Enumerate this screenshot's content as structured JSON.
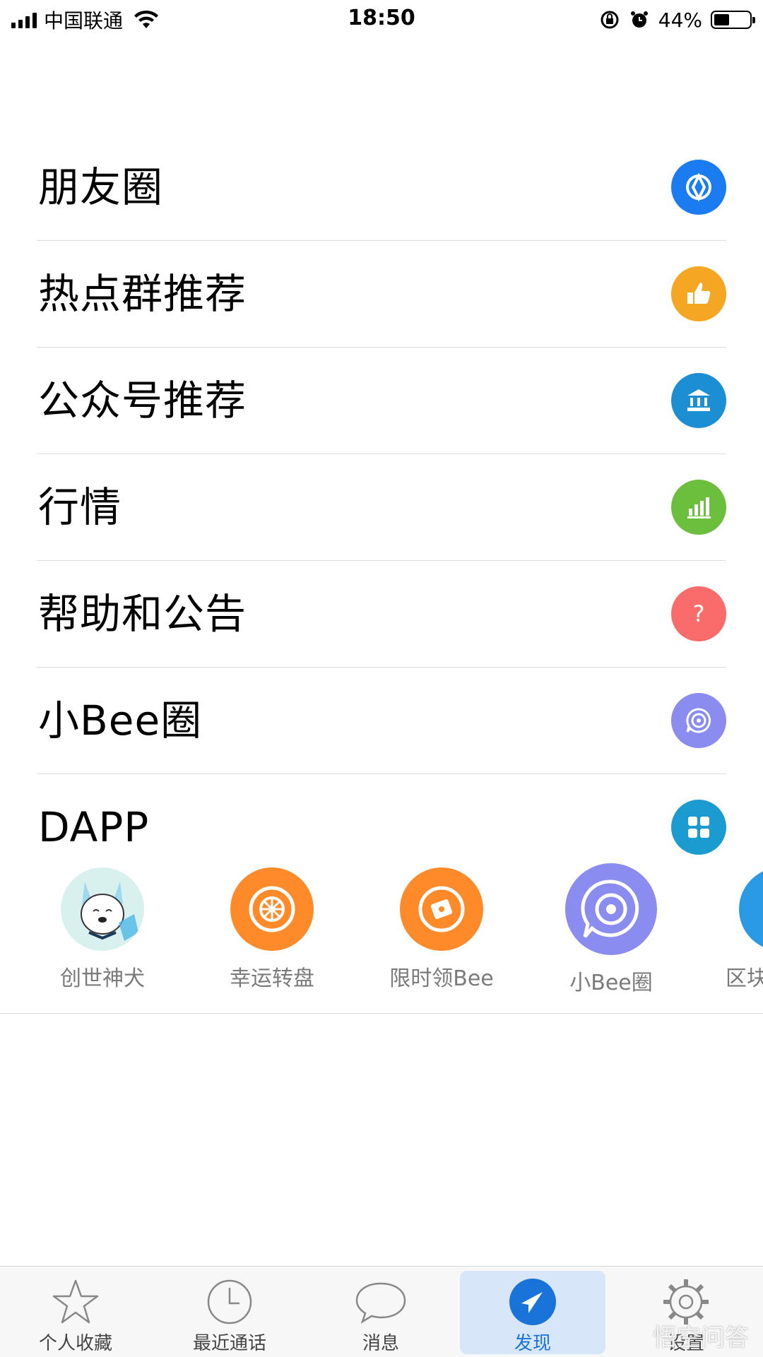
{
  "status_bar": {
    "carrier": "中国联通",
    "time": "18:50",
    "battery_percent": "44%",
    "battery_level": 0.44
  },
  "menu": {
    "items": [
      {
        "label": "朋友圈",
        "icon": "moments-shutter-icon",
        "color": "#1a7cf0"
      },
      {
        "label": "热点群推荐",
        "icon": "thumbs-up-icon",
        "color": "#f5a623"
      },
      {
        "label": "公众号推荐",
        "icon": "bank-building-icon",
        "color": "#1b8ed4"
      },
      {
        "label": "行情",
        "icon": "bar-chart-icon",
        "color": "#6cbf3c"
      },
      {
        "label": "帮助和公告",
        "icon": "question-icon",
        "color": "#fa6b6b"
      },
      {
        "label": "小Bee圈",
        "icon": "chat-target-icon",
        "color": "#8b8cf0"
      },
      {
        "label": "DAPP",
        "icon": "grid-apps-icon",
        "color": "#1b9bd0"
      }
    ]
  },
  "dapps": [
    {
      "label": "创世神犬",
      "icon": "dog-avatar-icon"
    },
    {
      "label": "幸运转盘",
      "icon": "wheel-icon",
      "color": "#ff8a2a"
    },
    {
      "label": "限时领Bee",
      "icon": "ticket-icon",
      "color": "#ff8a2a"
    },
    {
      "label": "小Bee圈",
      "icon": "chat-target-icon",
      "color": "#8b8cf0"
    },
    {
      "label": "区块",
      "icon": "partial-app-icon",
      "color": "#2a9ae6"
    }
  ],
  "tab_bar": {
    "tabs": [
      {
        "label": "个人收藏",
        "icon": "star-icon",
        "active": false
      },
      {
        "label": "最近通话",
        "icon": "clock-icon",
        "active": false
      },
      {
        "label": "消息",
        "icon": "speech-bubble-icon",
        "active": false
      },
      {
        "label": "发现",
        "icon": "compass-arrow-icon",
        "active": true
      },
      {
        "label": "设置",
        "icon": "gear-icon",
        "active": false
      }
    ],
    "accent": "#1a73d9"
  },
  "watermark": "悟空问答"
}
